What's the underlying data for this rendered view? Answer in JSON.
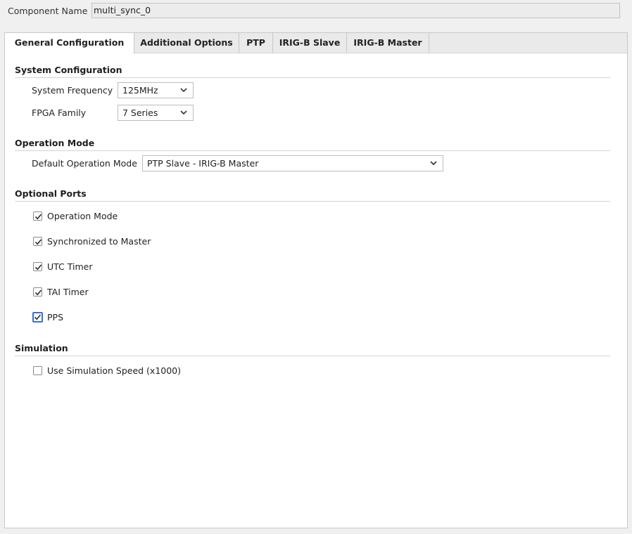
{
  "component": {
    "label": "Component Name",
    "value": "multi_sync_0"
  },
  "tabs": [
    {
      "label": "General Configuration",
      "active": true
    },
    {
      "label": "Additional Options",
      "active": false
    },
    {
      "label": "PTP",
      "active": false
    },
    {
      "label": "IRIG-B Slave",
      "active": false
    },
    {
      "label": "IRIG-B Master",
      "active": false
    }
  ],
  "system_configuration": {
    "title": "System Configuration",
    "frequency_label": "System Frequency",
    "frequency_value": "125MHz",
    "family_label": "FPGA Family",
    "family_value": "7 Series"
  },
  "operation_mode": {
    "title": "Operation Mode",
    "default_label": "Default Operation Mode",
    "default_value": "PTP Slave - IRIG-B Master"
  },
  "optional_ports": {
    "title": "Optional Ports",
    "items": [
      {
        "label": "Operation Mode",
        "checked": true
      },
      {
        "label": "Synchronized to Master",
        "checked": true
      },
      {
        "label": "UTC Timer",
        "checked": true
      },
      {
        "label": "TAI Timer",
        "checked": true
      },
      {
        "label": "PPS",
        "checked": true,
        "focused": true
      }
    ]
  },
  "simulation": {
    "title": "Simulation",
    "speed_label": "Use Simulation Speed (x1000)",
    "speed_checked": false
  },
  "icons": {
    "dropdown": "chevron-down-icon",
    "check": "checkmark-icon"
  },
  "colors": {
    "focus_accent": "#3a6fd0",
    "panel_bg": "#ffffff",
    "window_bg": "#f0f0f0"
  }
}
